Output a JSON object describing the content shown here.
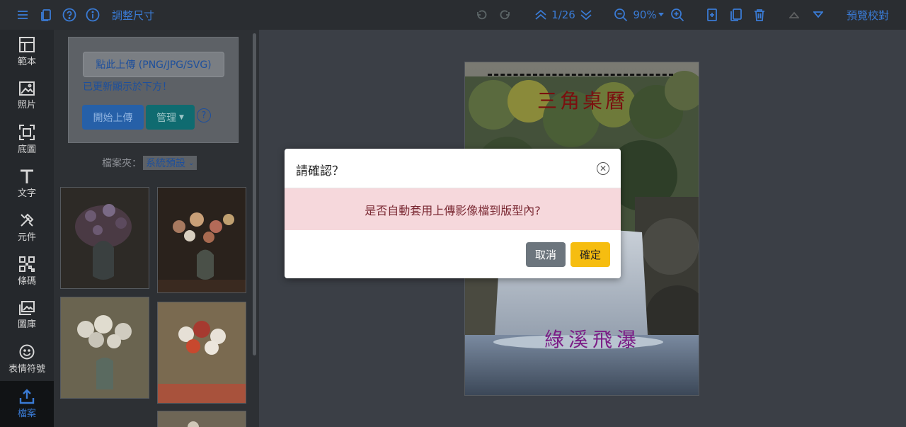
{
  "toolbar": {
    "resize_label": "調整尺寸",
    "page_indicator": "1/26",
    "zoom_level": "90%",
    "preview_label": "預覽校對",
    "accent_color": "#3a7bd5",
    "icons": [
      "menu-icon",
      "copy-icon",
      "help-icon",
      "info-icon",
      "undo-icon",
      "redo-icon",
      "page-up-icon",
      "page-down-icon",
      "zoom-out-icon",
      "zoom-in-icon",
      "add-page-icon",
      "duplicate-page-icon",
      "trash-icon",
      "move-up-icon",
      "move-down-icon"
    ]
  },
  "sidebar": {
    "items": [
      {
        "label": "範本",
        "icon": "template-icon"
      },
      {
        "label": "照片",
        "icon": "photo-icon"
      },
      {
        "label": "底圖",
        "icon": "background-icon"
      },
      {
        "label": "文字",
        "icon": "text-icon"
      },
      {
        "label": "元件",
        "icon": "component-icon"
      },
      {
        "label": "條碼",
        "icon": "qrcode-icon"
      },
      {
        "label": "圖庫",
        "icon": "gallery-icon"
      },
      {
        "label": "表情符號",
        "icon": "emoji-icon"
      },
      {
        "label": "檔案",
        "icon": "upload-icon",
        "active": true
      }
    ]
  },
  "upload_panel": {
    "upload_button": "點此上傳 (PNG/JPG/SVG)",
    "note": "已更新顯示於下方！",
    "start_upload": "開始上傳",
    "manage": "管理",
    "help": "?",
    "folder_label": "檔案夾：",
    "folder_value": "系統預設"
  },
  "card": {
    "title": "三角桌曆",
    "subtitle": "綠溪飛瀑"
  },
  "dialog": {
    "title": "請確認？",
    "message": "是否自動套用上傳影像檔到版型內?",
    "cancel": "取消",
    "confirm": "確定"
  }
}
